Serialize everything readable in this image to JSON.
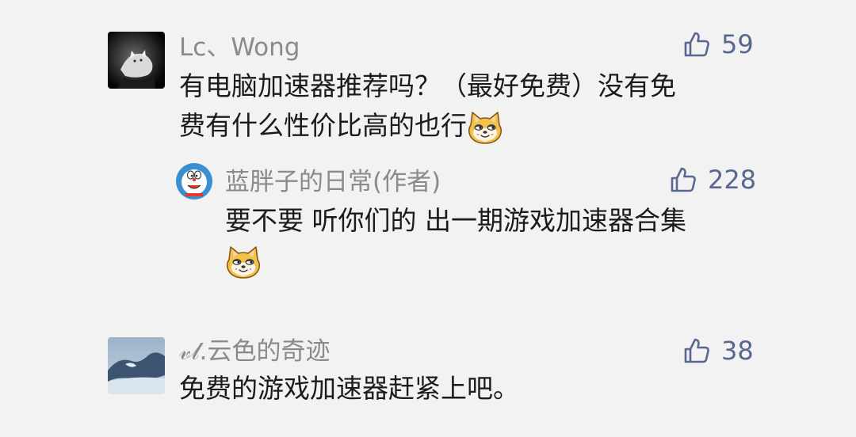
{
  "comments": [
    {
      "username": "Lc、Wong",
      "likes": "59",
      "text_line1": "有电脑加速器推荐吗？（最好免费）没有免",
      "text_line2": "费有什么性价比高的也行",
      "emoji": "doge-emoji"
    },
    {
      "username": "蓝胖子的日常(作者)",
      "likes": "228",
      "text_line1": "要不要 听你们的 出一期游戏加速器合集",
      "emoji": "doge-emoji"
    },
    {
      "username": "𝓋𝓁.云色的奇迹",
      "likes": "38",
      "text_line1": "免费的游戏加速器赶紧上吧。"
    }
  ],
  "colors": {
    "background": "#f2f2f2",
    "username": "#8a8a8a",
    "like": "#58678f",
    "text": "#1b1b1b"
  },
  "icons": {
    "like": "thumbs-up-icon"
  }
}
